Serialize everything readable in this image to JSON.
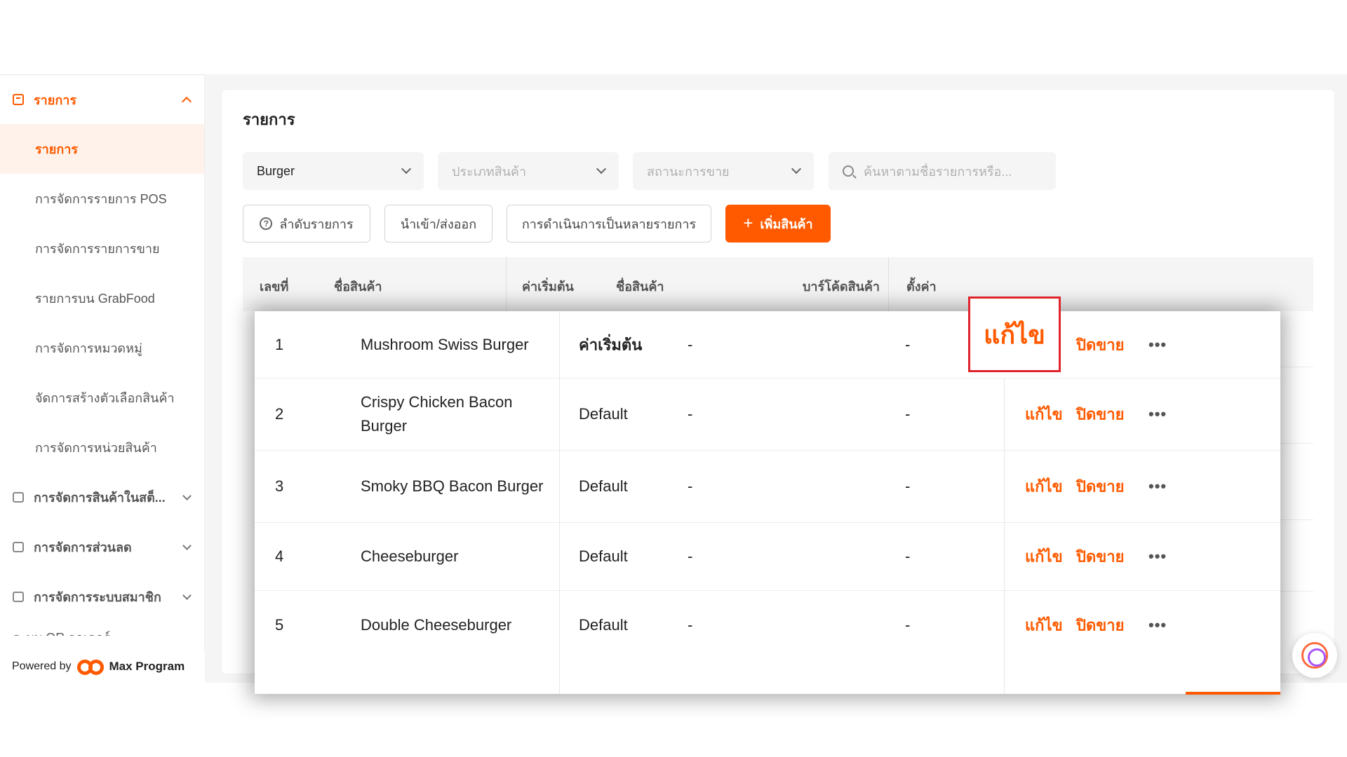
{
  "sidebar": {
    "section": {
      "label": "รายการ",
      "icon": "menu-book-icon"
    },
    "items": [
      {
        "label": "รายการ",
        "active": true
      },
      {
        "label": "การจัดการรายการ POS"
      },
      {
        "label": "การจัดการรายการขาย"
      },
      {
        "label": "รายการบน GrabFood"
      },
      {
        "label": "การจัดการหมวดหมู่"
      },
      {
        "label": "จัดการสร้างตัวเลือกสินค้า"
      },
      {
        "label": "การจัดการหน่วยสินค้า"
      }
    ],
    "groups": [
      {
        "label": "การจัดการสินค้าในสต็...",
        "icon": "store-icon"
      },
      {
        "label": "การจัดการส่วนลด",
        "icon": "coupon-icon"
      },
      {
        "label": "การจัดการระบบสมาชิก",
        "icon": "member-icon"
      }
    ],
    "cut_label": "ระบบ QR ออเดอร์",
    "powered_by": "Powered by",
    "brand": "Max Program"
  },
  "page": {
    "title": "รายการ"
  },
  "filters": {
    "category": "Burger",
    "type_placeholder": "ประเภทสินค้า",
    "status_placeholder": "สถานะการขาย",
    "search_placeholder": "ค้นหาตามชื่อรายการหรือ..."
  },
  "toolbar": {
    "sort": "ลำดับรายการ",
    "import_export": "นำเข้า/ส่งออก",
    "bulk": "การดำเนินการเป็นหลายรายการ",
    "add": "เพิ่มสินค้า"
  },
  "table": {
    "headers": [
      "เลขที่",
      "ชื่อสินค้า",
      "ค่าเริ่มต้น",
      "ชื่อสินค้า",
      "บาร์โค้ดสินค้า",
      "ตั้งค่า"
    ],
    "rows": [
      {
        "no": "1",
        "name": "Mushroom Swiss Burger",
        "price": "ค่าเริ่มต้น",
        "col4": "-",
        "col5": "-",
        "edit": "แก้ไข",
        "close": "ปิดขาย",
        "more": "•••"
      },
      {
        "no": "2",
        "name": "Crispy Chicken Bacon Burger",
        "price": "Default",
        "col4": "-",
        "col5": "-",
        "edit": "แก้ไข",
        "close": "ปิดขาย",
        "more": "•••"
      },
      {
        "no": "3",
        "name": "Smoky BBQ Bacon Burger",
        "price": "Default",
        "col4": "-",
        "col5": "-",
        "edit": "แก้ไข",
        "close": "ปิดขาย",
        "more": "•••"
      },
      {
        "no": "4",
        "name": "Cheeseburger",
        "price": "Default",
        "col4": "-",
        "col5": "-",
        "edit": "แก้ไข",
        "close": "ปิดขาย",
        "more": "•••"
      },
      {
        "no": "5",
        "name": "Double Cheeseburger",
        "price": "Default",
        "col4": "-",
        "col5": "-",
        "edit": "แก้ไข",
        "close": "ปิดขาย",
        "more": "•••"
      }
    ],
    "highlight_label": "แก้ไข"
  },
  "colors": {
    "accent": "#ff5a00",
    "highlight_border": "#e0242b"
  }
}
